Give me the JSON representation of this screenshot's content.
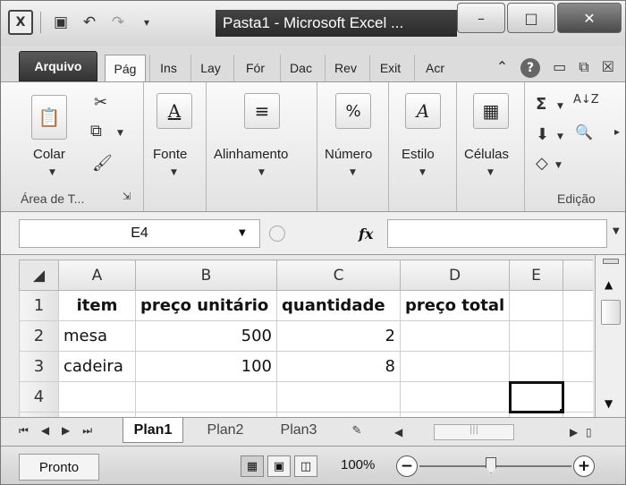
{
  "window": {
    "title": "Pasta1  -  Microsoft Excel ...",
    "minimize": "–",
    "maximize": "□",
    "close": "✕"
  },
  "qat": {
    "app_icon_glyph": "X",
    "save_glyph": "▣",
    "undo_glyph": "↶",
    "redo_glyph": "↷",
    "customize_glyph": "▾"
  },
  "tabs": [
    {
      "label": "Arquivo"
    },
    {
      "label": "Pág"
    },
    {
      "label": "Ins"
    },
    {
      "label": "Lay"
    },
    {
      "label": "Fór"
    },
    {
      "label": "Dac"
    },
    {
      "label": "Rev"
    },
    {
      "label": "Exit"
    },
    {
      "label": "Acr"
    }
  ],
  "tab_right": {
    "up": "⌃",
    "help": "?",
    "min": "▭",
    "restore": "⧉",
    "close": "☒"
  },
  "ribbon": {
    "clipboard": {
      "label": "Colar",
      "group": "Área de T...",
      "launcher": "⇲"
    },
    "font": {
      "label": "Fonte",
      "icon": "A"
    },
    "alignment": {
      "label": "Alinhamento",
      "icon": "≡"
    },
    "number": {
      "label": "Número",
      "icon": "%"
    },
    "style": {
      "label": "Estilo",
      "icon": "A"
    },
    "cells": {
      "label": "Células",
      "icon": "▦"
    },
    "editing": {
      "group": "Edição",
      "sum": "Σ",
      "sort": "A↓Z",
      "fill": "⬇",
      "find": "🔍",
      "clear": "◇"
    }
  },
  "formula_bar": {
    "name_box": "E4",
    "fx": "fx",
    "formula": ""
  },
  "grid": {
    "columns": [
      "A",
      "B",
      "C",
      "D",
      "E"
    ],
    "rows": [
      {
        "n": "1",
        "cells": [
          "item",
          "preço unitário",
          "quantidade",
          "preço total",
          ""
        ]
      },
      {
        "n": "2",
        "cells": [
          "mesa",
          "500",
          "2",
          "",
          ""
        ]
      },
      {
        "n": "3",
        "cells": [
          "cadeira",
          "100",
          "8",
          "",
          ""
        ]
      },
      {
        "n": "4",
        "cells": [
          "",
          "",
          "",
          "",
          ""
        ]
      }
    ],
    "selected_cell": "E4"
  },
  "sheets": {
    "tabs": [
      "Plan1",
      "Plan2",
      "Plan3"
    ],
    "active": "Plan1",
    "insert_glyph": "✎"
  },
  "status": {
    "text": "Pronto",
    "zoom": "100%",
    "zoom_out": "−",
    "zoom_in": "+"
  }
}
